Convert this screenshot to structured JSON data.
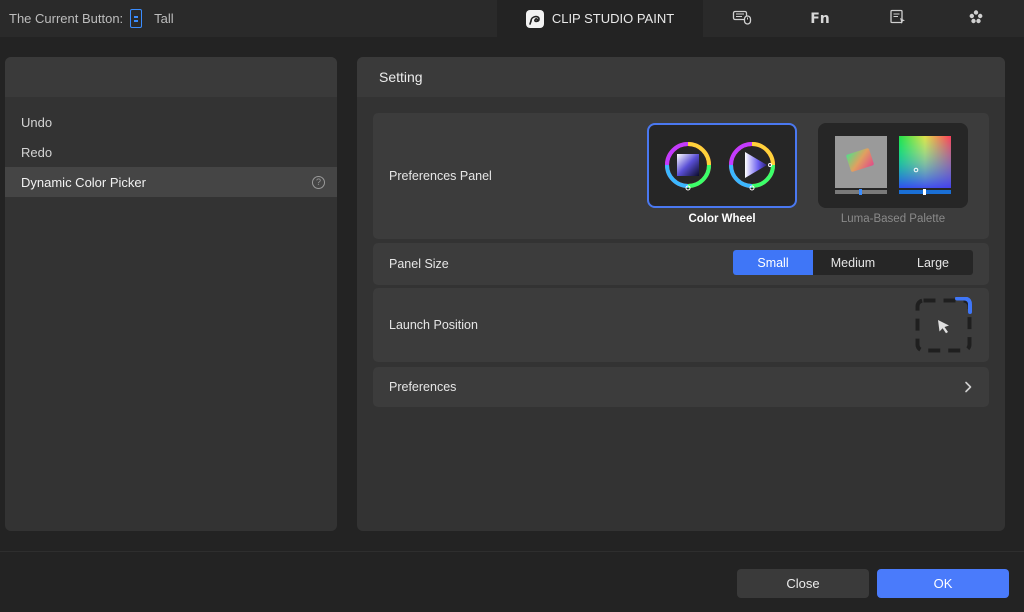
{
  "header": {
    "current_button_label": "The Current Button:",
    "current_button_value": "Tall",
    "tabs": [
      {
        "label": "CLIP STUDIO PAINT",
        "icon": "clip-studio-logo-icon",
        "active": true
      },
      {
        "label": "",
        "icon": "keyboard-mouse-icon",
        "active": false
      },
      {
        "label": "Fn",
        "icon": "fn-icon",
        "active": false
      },
      {
        "label": "",
        "icon": "document-pointer-icon",
        "active": false
      },
      {
        "label": "",
        "icon": "flower-icon",
        "active": false
      }
    ]
  },
  "sidebar": {
    "items": [
      {
        "label": "Undo",
        "selected": false
      },
      {
        "label": "Redo",
        "selected": false
      },
      {
        "label": "Dynamic Color Picker",
        "selected": true,
        "help_icon": "help-circle-icon",
        "help_text": "?"
      }
    ]
  },
  "settings": {
    "title": "Setting",
    "preferences_panel": {
      "label": "Preferences Panel",
      "options": [
        {
          "label": "Color Wheel",
          "selected": true
        },
        {
          "label": "Luma-Based Palette",
          "selected": false
        }
      ]
    },
    "panel_size": {
      "label": "Panel Size",
      "options": [
        "Small",
        "Medium",
        "Large"
      ],
      "selected": "Small"
    },
    "launch_position": {
      "label": "Launch Position",
      "icon": "launch-position-icon"
    },
    "preferences": {
      "label": "Preferences",
      "icon": "chevron-right-icon"
    }
  },
  "footer": {
    "close_label": "Close",
    "ok_label": "OK"
  },
  "colors": {
    "accent": "#4a7bfb",
    "background": "#232323",
    "panel": "#333333",
    "row": "#3c3c3c"
  }
}
